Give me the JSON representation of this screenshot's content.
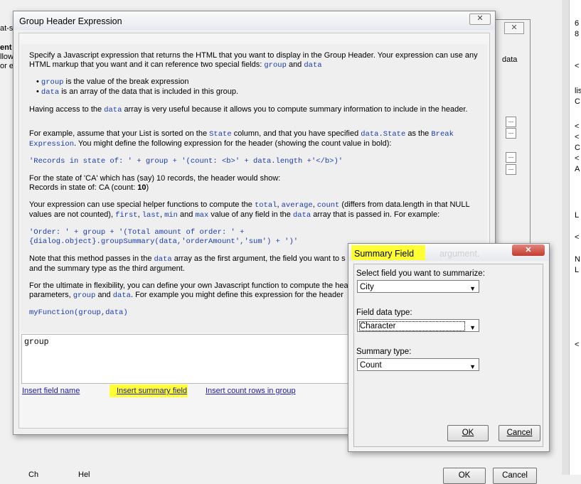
{
  "background": {
    "left_fragment": "at-si",
    "left_fragment2": "ent",
    "left_fragment3": "llow",
    "left_fragment4": "or e",
    "right_col_texts": [
      "6",
      "8",
      "<",
      "lis",
      "C",
      "<",
      "<",
      "C",
      "<",
      "A",
      "L",
      "<",
      "N",
      "L",
      "<"
    ],
    "mid_window_data": "data",
    "bottom_left": "Ch",
    "bottom_mid": "Hel",
    "bottom_ok": "OK",
    "bottom_cancel": "Cancel"
  },
  "main_dialog": {
    "title": "Group Header Expression",
    "close_glyph": "☒",
    "help": {
      "intro": "Specify a Javascript expression that returns the HTML that you want to display in the Group Header. Your expression can use any HTML markup that you want and it can reference two special fields: ",
      "intro_code1": "group",
      "intro_and": " and ",
      "intro_code2": "data",
      "bullet1_code": "group",
      "bullet1_text": " is the value of the break expression",
      "bullet2_code": "data",
      "bullet2_text": " is an array of the data that is included in this group.",
      "having1": "Having access to the ",
      "having_code": "data",
      "having2": " array is very useful because it allows you to compute summary information to include in the header.",
      "example1": "For example, assume that your List is sorted on the ",
      "example_code1": "State",
      "example2": " column, and that you have specified ",
      "example_code2": "data.State",
      "example3": " as the ",
      "example_code3": "Break Expression",
      "example4": ". You might define the following expression for the header (showing the count value in bold):",
      "code_example1": "'Records in state of: ' + group + '(count: <b>' + data.length +'</b>)'",
      "state_line": "For the state of 'CA' which has (say) 10 records, the header would show:",
      "result_line": "Records in state of: CA (count: ",
      "result_bold": "10",
      "result_end": ")",
      "helpers1": "Your expression can use special helper functions to compute the ",
      "helpers_total": "total",
      "helpers_comma1": ", ",
      "helpers_average": "average",
      "helpers_comma2": ", ",
      "helpers_count": "count",
      "helpers2": " (differs from data.length in that NULL values are not counted), ",
      "helpers_first": "first",
      "helpers_comma3": ", ",
      "helpers_last": "last",
      "helpers_comma4": ", ",
      "helpers_min": "min",
      "helpers_and": " and ",
      "helpers_max": "max",
      "helpers3": " value of any field in the ",
      "helpers_data": "data",
      "helpers4": " array that is passed in. For example:",
      "code_example2_line1": "'Order: ' + group + '(Total amount of order: ' +",
      "code_example2_line2": "{dialog.object}.groupSummary(data,'orderAmount','sum') + ')'",
      "note1": "Note that this method passes in the ",
      "note_code": "data",
      "note2": " array as the first argument, the field you want to s",
      "note3": "and the summary type as the third argument.",
      "ultimate1": "For the ultimate in flexibility, you can define your own Javascript function to compute the hea",
      "ultimate2": "parameters, ",
      "ultimate_code1": "group",
      "ultimate_and": " and ",
      "ultimate_code2": "data",
      "ultimate3": ". For example you might define this expression for the header",
      "code_example3": "myFunction(group,data)"
    },
    "expression_value": "group",
    "links": {
      "insert_field": "Insert field name",
      "insert_summary": "Insert summary field",
      "insert_count": "Insert count rows in group"
    }
  },
  "summary_dialog": {
    "title": "Summary Field",
    "close_glyph": "✕",
    "obscured_text": "argument.",
    "select_label": "Select field you want to summarize:",
    "select_value": "City",
    "type_label": "Field data type:",
    "type_value": "Character",
    "summary_label": "Summary type:",
    "summary_value": "Count",
    "ok_label": "OK",
    "cancel_label": "Cancel"
  },
  "colors": {
    "highlight": "#ffff33",
    "code": "#1a3caa",
    "close_red": "#c9453a",
    "link": "#1a1aa6"
  }
}
